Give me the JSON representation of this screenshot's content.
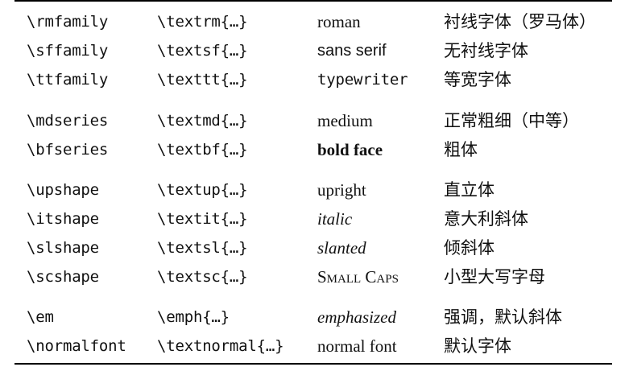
{
  "table": {
    "rows": [
      {
        "command": "\\rmfamily",
        "text_command": "\\textrm{…}",
        "sample": "roman",
        "description_cn": "衬线字体（罗马体）"
      },
      {
        "command": "\\sffamily",
        "text_command": "\\textsf{…}",
        "sample": "sans serif",
        "description_cn": "无衬线字体"
      },
      {
        "command": "\\ttfamily",
        "text_command": "\\texttt{…}",
        "sample": "typewriter",
        "description_cn": "等宽字体"
      },
      {
        "command": "\\mdseries",
        "text_command": "\\textmd{…}",
        "sample": "medium",
        "description_cn": "正常粗细（中等）"
      },
      {
        "command": "\\bfseries",
        "text_command": "\\textbf{…}",
        "sample": "bold face",
        "description_cn": "粗体"
      },
      {
        "command": "\\upshape",
        "text_command": "\\textup{…}",
        "sample": "upright",
        "description_cn": "直立体"
      },
      {
        "command": "\\itshape",
        "text_command": "\\textit{…}",
        "sample": "italic",
        "description_cn": "意大利斜体"
      },
      {
        "command": "\\slshape",
        "text_command": "\\textsl{…}",
        "sample": "slanted",
        "description_cn": "倾斜体"
      },
      {
        "command": "\\scshape",
        "text_command": "\\textsc{…}",
        "sample": "Small Caps",
        "description_cn": "小型大写字母"
      },
      {
        "command": "\\em",
        "text_command": "\\emph{…}",
        "sample": "emphasized",
        "description_cn": "强调，默认斜体"
      },
      {
        "command": "\\normalfont",
        "text_command": "\\textnormal{…}",
        "sample": "normal font",
        "description_cn": "默认字体"
      }
    ]
  }
}
